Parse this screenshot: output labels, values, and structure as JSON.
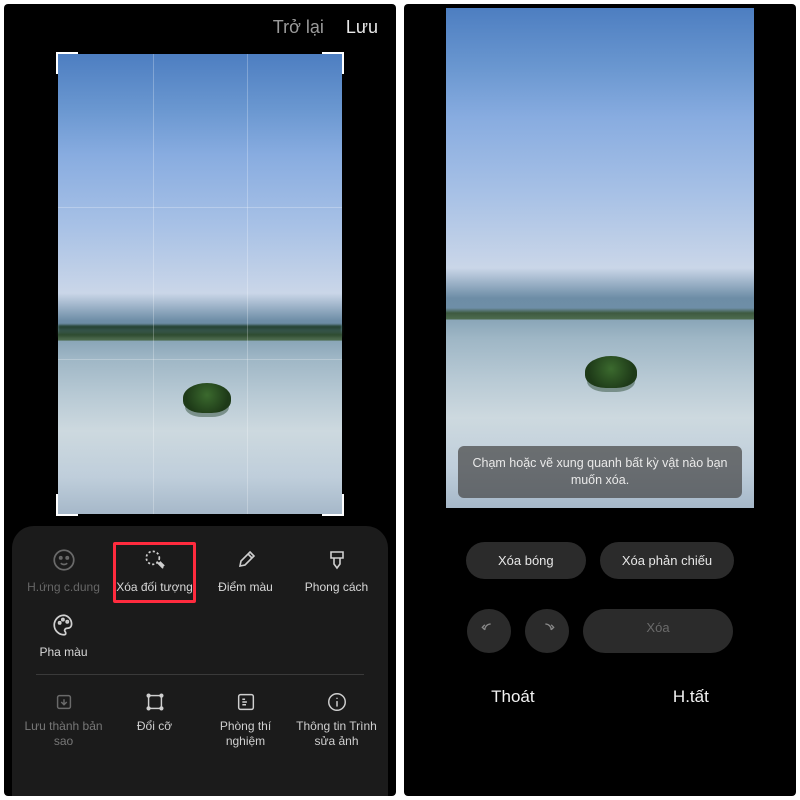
{
  "left": {
    "topbar": {
      "back": "Trở lại",
      "save": "Lưu"
    },
    "tools": [
      {
        "id": "portrait-effect",
        "label": "H.ứng c.dung",
        "disabled": true
      },
      {
        "id": "object-eraser",
        "label": "Xóa đối tượng",
        "highlighted": true
      },
      {
        "id": "spot-color",
        "label": "Điểm màu"
      },
      {
        "id": "style",
        "label": "Phong cách"
      },
      {
        "id": "color-mix",
        "label": "Pha màu"
      }
    ],
    "bottom": [
      {
        "id": "save-copy",
        "label": "Lưu thành bản sao",
        "dim": true
      },
      {
        "id": "resize",
        "label": "Đổi cỡ"
      },
      {
        "id": "labs",
        "label": "Phòng thí nghiệm"
      },
      {
        "id": "about",
        "label": "Thông tin Trình sửa ảnh"
      }
    ]
  },
  "right": {
    "hint": "Chạm hoặc vẽ xung quanh bất kỳ vật nào bạn muốn xóa.",
    "remove_shadow": "Xóa bóng",
    "remove_reflection": "Xóa phản chiếu",
    "erase": "Xóa",
    "exit": "Thoát",
    "done": "H.tất"
  }
}
